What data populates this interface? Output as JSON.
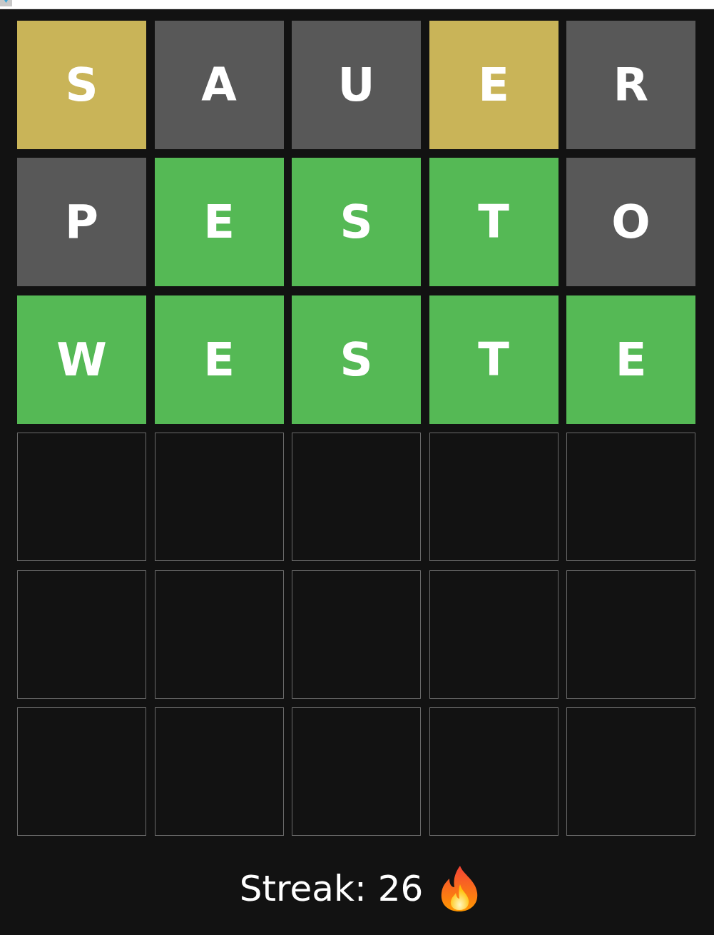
{
  "board": {
    "rows": [
      {
        "tiles": [
          {
            "kind": "filled",
            "letter": "S",
            "color": "#c9b458"
          },
          {
            "kind": "filled",
            "letter": "A",
            "color": "#585858"
          },
          {
            "kind": "filled",
            "letter": "U",
            "color": "#585858"
          },
          {
            "kind": "filled",
            "letter": "E",
            "color": "#c9b458"
          },
          {
            "kind": "filled",
            "letter": "R",
            "color": "#585858"
          }
        ]
      },
      {
        "tiles": [
          {
            "kind": "filled",
            "letter": "P",
            "color": "#585858"
          },
          {
            "kind": "filled",
            "letter": "E",
            "color": "#55b955"
          },
          {
            "kind": "filled",
            "letter": "S",
            "color": "#55b955"
          },
          {
            "kind": "filled",
            "letter": "T",
            "color": "#55b955"
          },
          {
            "kind": "filled",
            "letter": "O",
            "color": "#585858"
          }
        ]
      },
      {
        "tiles": [
          {
            "kind": "filled",
            "letter": "W",
            "color": "#55b955"
          },
          {
            "kind": "filled",
            "letter": "E",
            "color": "#55b955"
          },
          {
            "kind": "filled",
            "letter": "S",
            "color": "#55b955"
          },
          {
            "kind": "filled",
            "letter": "T",
            "color": "#55b955"
          },
          {
            "kind": "filled",
            "letter": "E",
            "color": "#55b955"
          }
        ]
      },
      {
        "tiles": [
          {
            "kind": "empty"
          },
          {
            "kind": "empty"
          },
          {
            "kind": "empty"
          },
          {
            "kind": "empty"
          },
          {
            "kind": "empty"
          }
        ]
      },
      {
        "tiles": [
          {
            "kind": "empty"
          },
          {
            "kind": "empty"
          },
          {
            "kind": "empty"
          },
          {
            "kind": "empty"
          },
          {
            "kind": "empty"
          }
        ]
      },
      {
        "tiles": [
          {
            "kind": "empty"
          },
          {
            "kind": "empty"
          },
          {
            "kind": "empty"
          },
          {
            "kind": "empty"
          },
          {
            "kind": "empty"
          }
        ]
      }
    ]
  },
  "streak": {
    "label": "Streak: 26"
  }
}
